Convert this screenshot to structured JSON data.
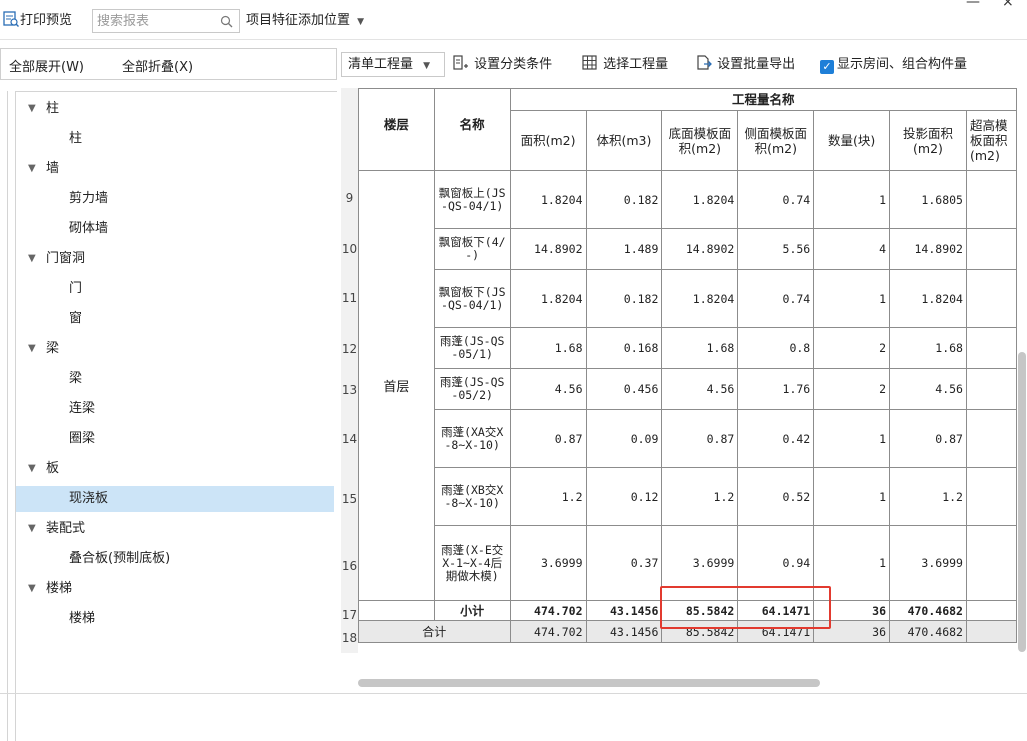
{
  "toolbar": {
    "print_preview": "打印预览",
    "search_placeholder": "搜索报表",
    "feature_position": "项目特征添加位置",
    "window_minimize": "—",
    "window_close": "×"
  },
  "left_panel": {
    "expand_all": "全部展开(W)",
    "collapse_all": "全部折叠(X)",
    "tree": [
      {
        "label": "柱",
        "level": 0
      },
      {
        "label": "柱",
        "level": 1
      },
      {
        "label": "墙",
        "level": 0
      },
      {
        "label": "剪力墙",
        "level": 1
      },
      {
        "label": "砌体墙",
        "level": 1
      },
      {
        "label": "门窗洞",
        "level": 0
      },
      {
        "label": "门",
        "level": 1
      },
      {
        "label": "窗",
        "level": 1
      },
      {
        "label": "梁",
        "level": 0
      },
      {
        "label": "梁",
        "level": 1
      },
      {
        "label": "连梁",
        "level": 1
      },
      {
        "label": "圈梁",
        "level": 1
      },
      {
        "label": "板",
        "level": 0
      },
      {
        "label": "现浇板",
        "level": 1,
        "selected": true
      },
      {
        "label": "装配式",
        "level": 0
      },
      {
        "label": "叠合板(预制底板)",
        "level": 1
      },
      {
        "label": "楼梯",
        "level": 0
      },
      {
        "label": "楼梯",
        "level": 1
      }
    ]
  },
  "right_toolbar": {
    "quantity_select": "清单工程量",
    "set_category": "设置分类条件",
    "select_quantity": "选择工程量",
    "batch_export": "设置批量导出",
    "show_rooms": "显示房间、组合构件量"
  },
  "grid": {
    "header": {
      "floor": "楼层",
      "name": "名称",
      "group": "工程量名称",
      "columns": [
        "面积(m2)",
        "体积(m3)",
        "底面模板面积(m2)",
        "侧面模板面积(m2)",
        "数量(块)",
        "投影面积(m2)",
        "超高模板面积(m2)"
      ]
    },
    "floor_label": "首层",
    "rows": [
      {
        "num": "9",
        "name": "飘窗板上(JS-QS-04/1)",
        "values": [
          "1.8204",
          "0.182",
          "1.8204",
          "0.74",
          "1",
          "1.6805"
        ]
      },
      {
        "num": "10",
        "name": "飘窗板下(4/-)",
        "values": [
          "14.8902",
          "1.489",
          "14.8902",
          "5.56",
          "4",
          "14.8902"
        ]
      },
      {
        "num": "11",
        "name": "飘窗板下(JS-QS-04/1)",
        "values": [
          "1.8204",
          "0.182",
          "1.8204",
          "0.74",
          "1",
          "1.8204"
        ]
      },
      {
        "num": "12",
        "name": "雨蓬(JS-QS-05/1)",
        "values": [
          "1.68",
          "0.168",
          "1.68",
          "0.8",
          "2",
          "1.68"
        ]
      },
      {
        "num": "13",
        "name": "雨蓬(JS-QS-05/2)",
        "values": [
          "4.56",
          "0.456",
          "4.56",
          "1.76",
          "2",
          "4.56"
        ]
      },
      {
        "num": "14",
        "name": "雨蓬(XA交X-8~X-10)",
        "values": [
          "0.87",
          "0.09",
          "0.87",
          "0.42",
          "1",
          "0.87"
        ]
      },
      {
        "num": "15",
        "name": "雨蓬(XB交X-8~X-10)",
        "values": [
          "1.2",
          "0.12",
          "1.2",
          "0.52",
          "1",
          "1.2"
        ]
      },
      {
        "num": "16",
        "name": "雨蓬(X-E交X-1~X-4后期做木模)",
        "values": [
          "3.6999",
          "0.37",
          "3.6999",
          "0.94",
          "1",
          "3.6999"
        ]
      }
    ],
    "subtotal": {
      "num": "17",
      "label": "小计",
      "values": [
        "474.702",
        "43.1456",
        "85.5842",
        "64.1471",
        "36",
        "470.4682"
      ]
    },
    "total": {
      "num": "18",
      "label": "合计",
      "values": [
        "474.702",
        "43.1456",
        "85.5842",
        "64.1471",
        "36",
        "470.4682"
      ]
    }
  },
  "colors": {
    "highlight_box": "#e23a2f",
    "selected_row": "#cce4f7",
    "checkbox": "#1e7fd8"
  }
}
